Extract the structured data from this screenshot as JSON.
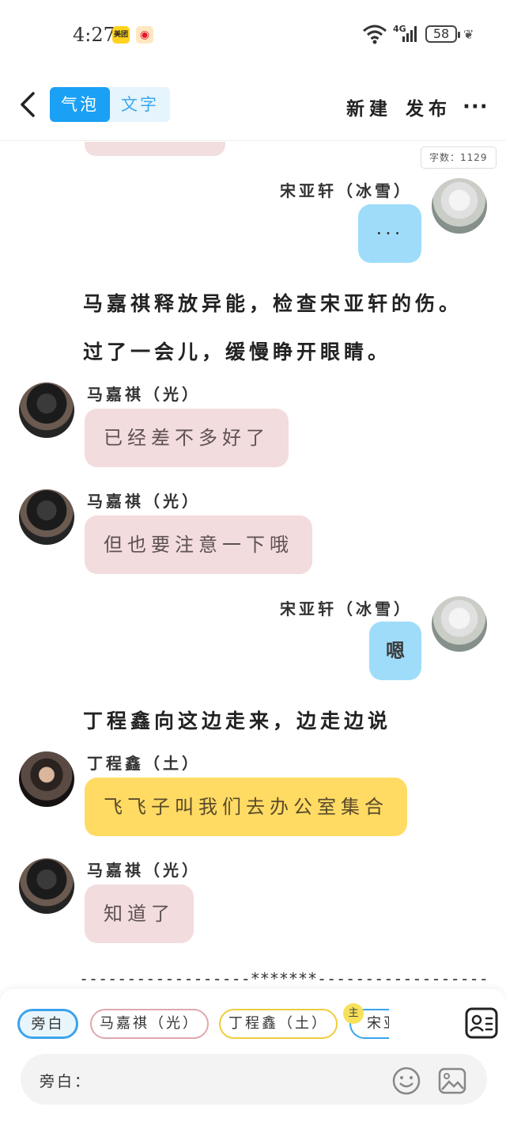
{
  "status_bar": {
    "time": "4:27",
    "app_icons": [
      "meituan-icon",
      "weibo-icon"
    ],
    "meituan_label": "美团",
    "network": "4G",
    "battery": "58"
  },
  "toolbar": {
    "mode_bubble": "气泡",
    "mode_text": "文字",
    "new_label": "新建",
    "publish_label": "发布",
    "more_label": "···"
  },
  "word_count": "字数：1129",
  "messages": [
    {
      "type": "bubble",
      "side": "right",
      "speaker": "宋亚轩（冰雪）",
      "text": "···",
      "color": "#9fdcfa"
    },
    {
      "type": "narration",
      "text": "马嘉祺释放异能，检查宋亚轩的伤。"
    },
    {
      "type": "narration",
      "text": "过了一会儿，缓慢睁开眼睛。"
    },
    {
      "type": "bubble",
      "side": "left",
      "speaker": "马嘉祺（光）",
      "text": "已经差不多好了",
      "color": "#f3dcdd"
    },
    {
      "type": "bubble",
      "side": "left",
      "speaker": "马嘉祺（光）",
      "text": "但也要注意一下哦",
      "color": "#f3dcdd"
    },
    {
      "type": "bubble",
      "side": "right",
      "speaker": "宋亚轩（冰雪）",
      "text": "嗯",
      "color": "#9fdcfa"
    },
    {
      "type": "narration",
      "text": "丁程鑫向这边走来，边走边说"
    },
    {
      "type": "bubble",
      "side": "left",
      "speaker": "丁程鑫（土）",
      "text": "飞飞子叫我们去办公室集合",
      "color": "#ffdb63"
    },
    {
      "type": "bubble",
      "side": "left",
      "speaker": "马嘉祺（光）",
      "text": "知道了",
      "color": "#f3dcdd"
    },
    {
      "type": "divider",
      "text": "------------------*******------------------"
    }
  ],
  "role_chips": [
    {
      "label": "旁白",
      "selected": true
    },
    {
      "label": "马嘉祺（光）",
      "selected": false
    },
    {
      "label": "丁程鑫（土）",
      "selected": false
    },
    {
      "label": "宋亚",
      "selected": false
    }
  ],
  "main_badge": "主",
  "input": {
    "label": "旁白："
  },
  "colors": {
    "accent_blue": "#1aa0f5",
    "pink_bubble": "#f3dcdd",
    "blue_bubble": "#9fdcfa",
    "yellow_bubble": "#ffdb63"
  }
}
